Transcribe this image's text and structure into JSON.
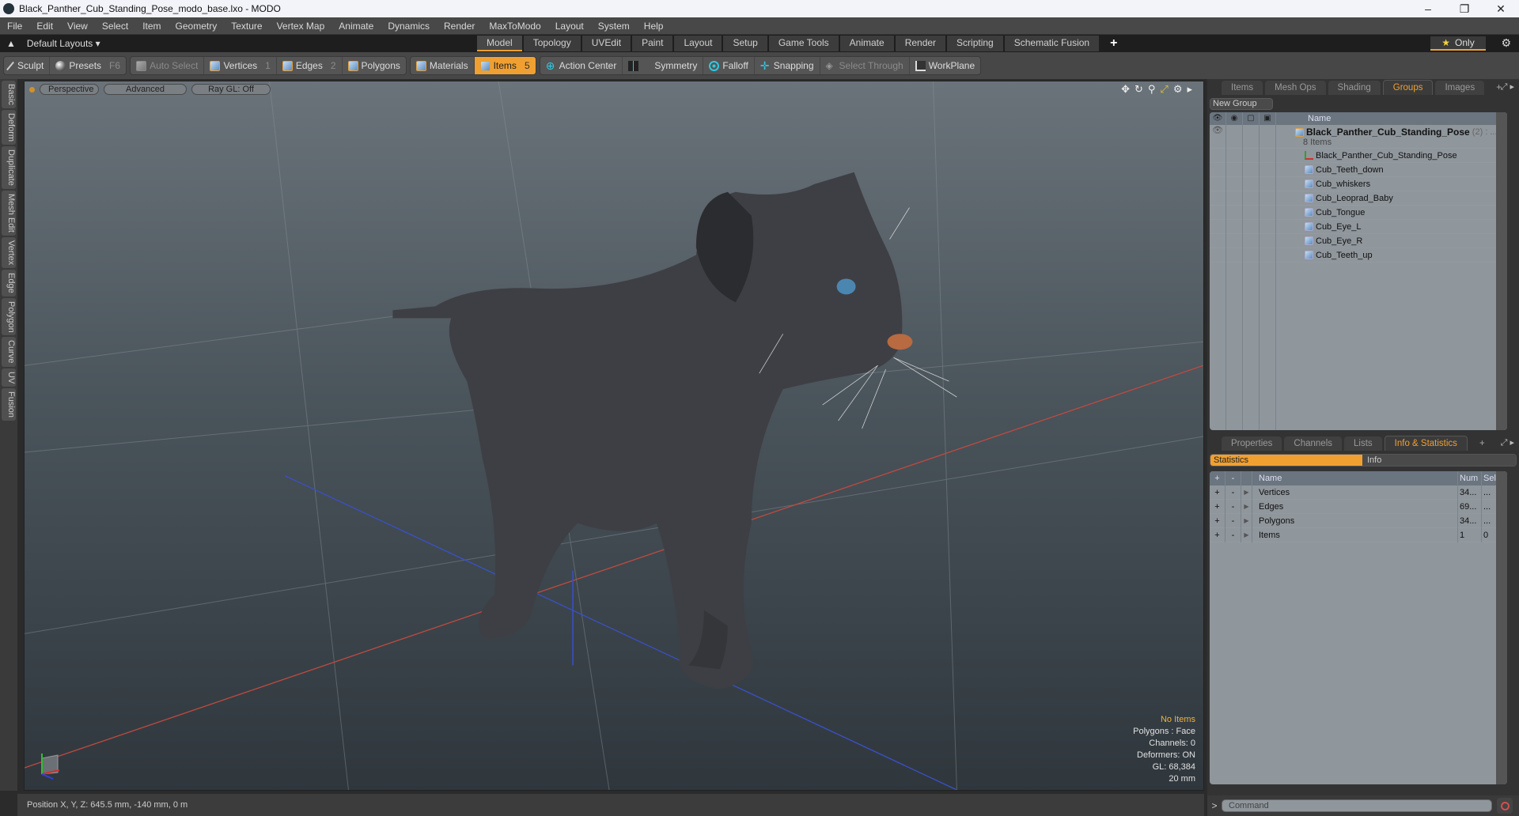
{
  "window": {
    "title": "Black_Panther_Cub_Standing_Pose_modo_base.lxo - MODO",
    "controls": [
      "minimize",
      "maximize",
      "close"
    ]
  },
  "menu": [
    "File",
    "Edit",
    "View",
    "Select",
    "Item",
    "Geometry",
    "Texture",
    "Vertex Map",
    "Animate",
    "Dynamics",
    "Render",
    "MaxToModo",
    "Layout",
    "System",
    "Help"
  ],
  "layoutbar": {
    "layouts_label": "Default Layouts",
    "mode_tabs": [
      "Model",
      "Topology",
      "UVEdit",
      "Paint",
      "Layout",
      "Setup",
      "Game Tools",
      "Animate",
      "Render",
      "Scripting",
      "Schematic Fusion"
    ],
    "active_tab": "Model",
    "only_label": "Only"
  },
  "toolbar": {
    "sculpt": "Sculpt",
    "presets": "Presets",
    "presets_key": "F6",
    "auto_select": "Auto Select",
    "vertices": "Vertices",
    "vertices_key": "1",
    "edges": "Edges",
    "edges_key": "2",
    "polygons": "Polygons",
    "materials": "Materials",
    "items": "Items",
    "items_key": "5",
    "action_center": "Action Center",
    "symmetry": "Symmetry",
    "falloff": "Falloff",
    "snapping": "Snapping",
    "select_through": "Select Through",
    "workplane": "WorkPlane"
  },
  "left_tabs": [
    "Basic",
    "Deform",
    "Duplicate",
    "Mesh Edit",
    "Vertex",
    "Edge",
    "Polygon",
    "Curve",
    "UV",
    "Fusion"
  ],
  "viewport": {
    "view_mode": "Perspective",
    "shading": "Advanced",
    "raygl": "Ray GL: Off",
    "info": {
      "selection": "No Items",
      "polygons": "Polygons : Face",
      "channels": "Channels: 0",
      "deformers": "Deformers: ON",
      "gl": "GL: 68,384",
      "scale": "20 mm"
    }
  },
  "status": {
    "position": "Position X, Y, Z:   645.5 mm, -140 mm, 0 m"
  },
  "upper_panel": {
    "tabs": [
      "Items",
      "Mesh Ops",
      "Shading",
      "Groups",
      "Images"
    ],
    "active_tab": "Groups",
    "new_group": "New Group",
    "name_header": "Name",
    "group": {
      "name": "Black_Panther_Cub_Standing_Pose",
      "count": "(2)",
      "suffix": ": ...",
      "items_label": "8 Items"
    },
    "items": [
      {
        "name": "Black_Panther_Cub_Standing_Pose",
        "type": "locator"
      },
      {
        "name": "Cub_Teeth_down",
        "type": "mesh"
      },
      {
        "name": "Cub_whiskers",
        "type": "mesh"
      },
      {
        "name": "Cub_Leoprad_Baby",
        "type": "mesh"
      },
      {
        "name": "Cub_Tongue",
        "type": "mesh"
      },
      {
        "name": "Cub_Eye_L",
        "type": "mesh"
      },
      {
        "name": "Cub_Eye_R",
        "type": "mesh"
      },
      {
        "name": "Cub_Teeth_up",
        "type": "mesh"
      }
    ]
  },
  "lower_panel": {
    "tabs": [
      "Properties",
      "Channels",
      "Lists",
      "Info & Statistics"
    ],
    "active_tab": "Info & Statistics",
    "toggle": {
      "statistics": "Statistics",
      "info": "Info"
    },
    "headers": {
      "plus": "+",
      "minus": "-",
      "name": "Name",
      "num": "Num",
      "sel": "Sel"
    },
    "rows": [
      {
        "name": "Vertices",
        "num": "34...",
        "sel": "..."
      },
      {
        "name": "Edges",
        "num": "69...",
        "sel": "..."
      },
      {
        "name": "Polygons",
        "num": "34...",
        "sel": "..."
      },
      {
        "name": "Items",
        "num": "1",
        "sel": "0"
      }
    ]
  },
  "command": {
    "placeholder": "Command",
    "prompt": ">"
  },
  "colors": {
    "accent": "#f0a030",
    "panel_bg": "#8f969c"
  }
}
